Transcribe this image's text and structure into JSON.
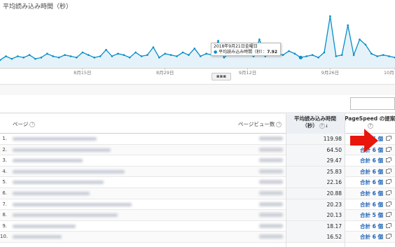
{
  "chart": {
    "title": "平均読み込み時間（秒）",
    "x_ticks": [
      "8月15日",
      "8月29日",
      "9月12日",
      "9月26日",
      "10月"
    ],
    "tooltip": {
      "date": "2018年9月21日金曜日",
      "metric": "平均読み込み時間（秒）",
      "value": "7.92"
    },
    "handle": "▪▪▪",
    "color": "#058dc7",
    "fill": "#e6f2f9"
  },
  "chart_data": {
    "type": "area",
    "x": [
      "8/1",
      "8/2",
      "8/3",
      "8/4",
      "8/5",
      "8/6",
      "8/7",
      "8/8",
      "8/9",
      "8/10",
      "8/11",
      "8/12",
      "8/13",
      "8/14",
      "8/15",
      "8/16",
      "8/17",
      "8/18",
      "8/19",
      "8/20",
      "8/21",
      "8/22",
      "8/23",
      "8/24",
      "8/25",
      "8/26",
      "8/27",
      "8/28",
      "8/29",
      "8/30",
      "8/31",
      "9/1",
      "9/2",
      "9/3",
      "9/4",
      "9/5",
      "9/6",
      "9/7",
      "9/8",
      "9/9",
      "9/10",
      "9/11",
      "9/12",
      "9/13",
      "9/14",
      "9/15",
      "9/16",
      "9/17",
      "9/18",
      "9/19",
      "9/20",
      "9/21",
      "9/22",
      "9/23",
      "9/24",
      "9/25",
      "9/26",
      "9/27",
      "9/28",
      "9/29",
      "9/30",
      "10/1",
      "10/2",
      "10/3",
      "10/4",
      "10/5",
      "10/6",
      "10/7"
    ],
    "series": [
      {
        "name": "平均読み込み時間（秒）",
        "values": [
          6,
          9,
          7,
          9,
          8,
          10,
          7,
          8,
          11,
          9,
          8,
          10,
          9,
          8,
          12,
          10,
          8,
          9,
          14,
          9,
          11,
          10,
          8,
          12,
          9,
          10,
          16,
          8,
          11,
          10,
          9,
          12,
          10,
          15,
          9,
          11,
          10,
          21,
          8,
          12,
          10,
          14,
          11,
          9,
          22,
          9,
          16,
          11,
          10,
          13,
          11,
          8,
          9,
          10,
          8,
          12,
          40,
          9,
          10,
          33,
          10,
          22,
          18,
          11,
          9,
          10,
          9,
          8
        ]
      }
    ],
    "ylim": [
      0,
      45
    ],
    "grid": false
  },
  "controls": {
    "search_value": ""
  },
  "table": {
    "headers": {
      "page": "ページ",
      "pageviews": "ページビュー数",
      "avg_load_line1": "平均読み込み時間",
      "avg_load_line2": "（秒）",
      "sort_indicator": "↓",
      "pagespeed": "PageSpeed の提案",
      "help": "?"
    },
    "rows": [
      {
        "num": "1.",
        "avg": "119.98",
        "ps": "合計 6 個"
      },
      {
        "num": "2.",
        "avg": "64.50",
        "ps": "合計 6 個"
      },
      {
        "num": "3.",
        "avg": "29.47",
        "ps": "合計 6 個"
      },
      {
        "num": "4.",
        "avg": "25.83",
        "ps": "合計 6 個"
      },
      {
        "num": "5.",
        "avg": "22.16",
        "ps": "合計 6 個"
      },
      {
        "num": "6.",
        "avg": "20.88",
        "ps": "合計 6 個"
      },
      {
        "num": "7.",
        "avg": "20.23",
        "ps": "合計 6 個"
      },
      {
        "num": "8.",
        "avg": "20.13",
        "ps": "合計 5 個"
      },
      {
        "num": "9.",
        "avg": "18.17",
        "ps": "合計 6 個"
      },
      {
        "num": "10.",
        "avg": "16.52",
        "ps": "合計 6 個"
      }
    ]
  },
  "annotation": {
    "arrow_color": "#e8160c"
  }
}
